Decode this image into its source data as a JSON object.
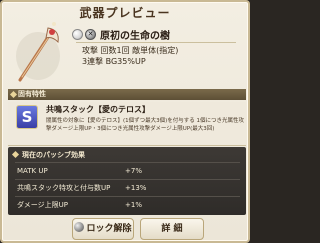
{
  "dialog": {
    "title": "武器プレビュー"
  },
  "weapon": {
    "name": "原初の生命の樹",
    "element_icon": "light-element-icon",
    "stats": [
      "攻撃 回数1回 敵単体(指定)",
      "3連撃 BG35%UP"
    ]
  },
  "sections": {
    "trait_header": "固有特性",
    "passive_header": "現在のパッシブ効果"
  },
  "skill": {
    "icon_letter": "S",
    "name": "共鳴スタック【愛のテロス】",
    "description": "闇属性の対象に【愛のテロス】(1個ずつ最大3個)を付与する 1個につき光属性攻撃ダメージ上限UP・3個につき光属性攻撃ダメージ上限UP(最大3回)"
  },
  "passives": [
    {
      "label": "MATK UP",
      "value": "+7%"
    },
    {
      "label": "共鳴スタック特攻と付与数UP",
      "value": "+13%"
    },
    {
      "label": "ダメージ上限UP",
      "value": "+1%"
    }
  ],
  "buttons": {
    "lock": "ロック解除",
    "detail": "詳 細"
  }
}
